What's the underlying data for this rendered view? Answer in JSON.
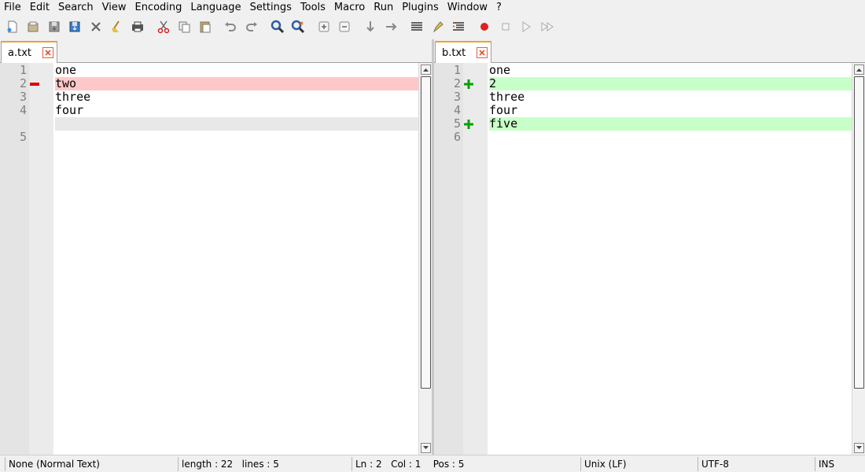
{
  "menu": [
    "File",
    "Edit",
    "Search",
    "View",
    "Encoding",
    "Language",
    "Settings",
    "Tools",
    "Macro",
    "Run",
    "Plugins",
    "Window",
    "?"
  ],
  "toolbar": {
    "icons": [
      "new-file-icon",
      "open-file-icon",
      "save-icon",
      "save-all-icon",
      "close-icon",
      "close-all-icon",
      "print-icon",
      "cut-icon",
      "copy-icon",
      "paste-icon",
      "undo-icon",
      "redo-icon",
      "find-icon",
      "replace-icon",
      "zoom-in-icon",
      "zoom-out-icon",
      "sync-vertical-icon",
      "sync-horizontal-icon",
      "word-wrap-icon",
      "highlighter-icon",
      "indent-guide-icon",
      "macro-record-icon",
      "macro-stop-icon",
      "macro-play-icon",
      "macro-run-multiple-icon"
    ]
  },
  "left": {
    "tab_label": "a.txt",
    "lines": [
      {
        "num": "1",
        "text": "one",
        "state": "normal"
      },
      {
        "num": "2",
        "text": "two",
        "state": "removed"
      },
      {
        "num": "3",
        "text": "three",
        "state": "normal"
      },
      {
        "num": "4",
        "text": "four",
        "state": "normal"
      },
      {
        "num": "",
        "text": "",
        "state": "blank"
      },
      {
        "num": "5",
        "text": "",
        "state": "normal"
      }
    ]
  },
  "right": {
    "tab_label": "b.txt",
    "lines": [
      {
        "num": "1",
        "text": "one",
        "state": "normal"
      },
      {
        "num": "2",
        "text": "2",
        "state": "added"
      },
      {
        "num": "3",
        "text": "three",
        "state": "normal"
      },
      {
        "num": "4",
        "text": "four",
        "state": "normal"
      },
      {
        "num": "5",
        "text": "five",
        "state": "added"
      },
      {
        "num": "6",
        "text": "",
        "state": "normal"
      }
    ]
  },
  "colors": {
    "removed": "#ffc8c8",
    "added": "#c8ffc8",
    "removed_marker": "#e00000",
    "added_marker": "#00a000"
  },
  "status": {
    "language": "None (Normal Text)",
    "length": "length : 22",
    "lines": "lines : 5",
    "ln": "Ln : 2",
    "col": "Col : 1",
    "pos": "Pos : 5",
    "eol": "Unix (LF)",
    "encoding": "UTF-8",
    "mode": "INS"
  }
}
